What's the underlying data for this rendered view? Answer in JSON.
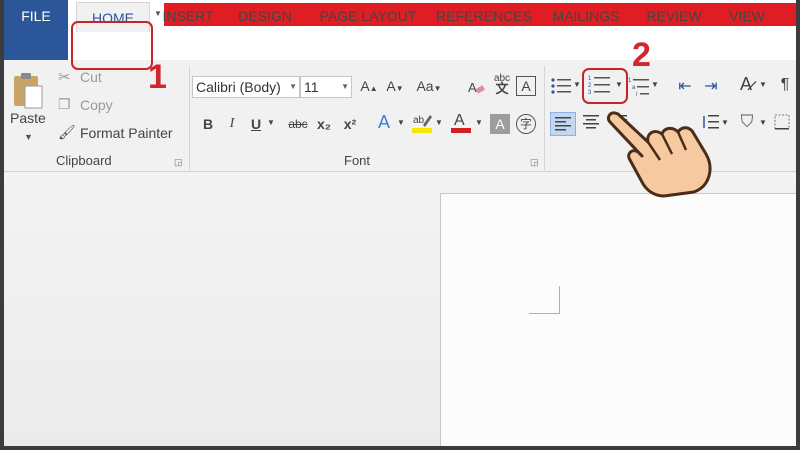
{
  "tabs": {
    "file": "FILE",
    "home": "HOME",
    "insert": "INSERT",
    "design": "DESIGN",
    "page_layout": "PAGE LAYOUT",
    "references": "REFERENCES",
    "mailings": "MAILINGS",
    "review": "REVIEW",
    "view": "VIEW"
  },
  "clipboard": {
    "paste": "Paste",
    "cut": "Cut",
    "copy": "Copy",
    "format_painter": "Format Painter",
    "group_label": "Clipboard"
  },
  "font": {
    "font_name": "Calibri (Body)",
    "font_size": "11",
    "group_label": "Font"
  },
  "format_buttons": {
    "bold": "B",
    "italic": "I",
    "underline": "U",
    "strikethrough": "abc",
    "subscript": "x₂",
    "superscript": "x²"
  },
  "annotations": {
    "step1": "1",
    "step2": "2"
  },
  "colors": {
    "accent_blue": "#2b579a",
    "title_red": "#e01d22",
    "annotation_red": "#c8232a",
    "highlight_yellow": "#f6e600",
    "font_color_red": "#d02020"
  }
}
